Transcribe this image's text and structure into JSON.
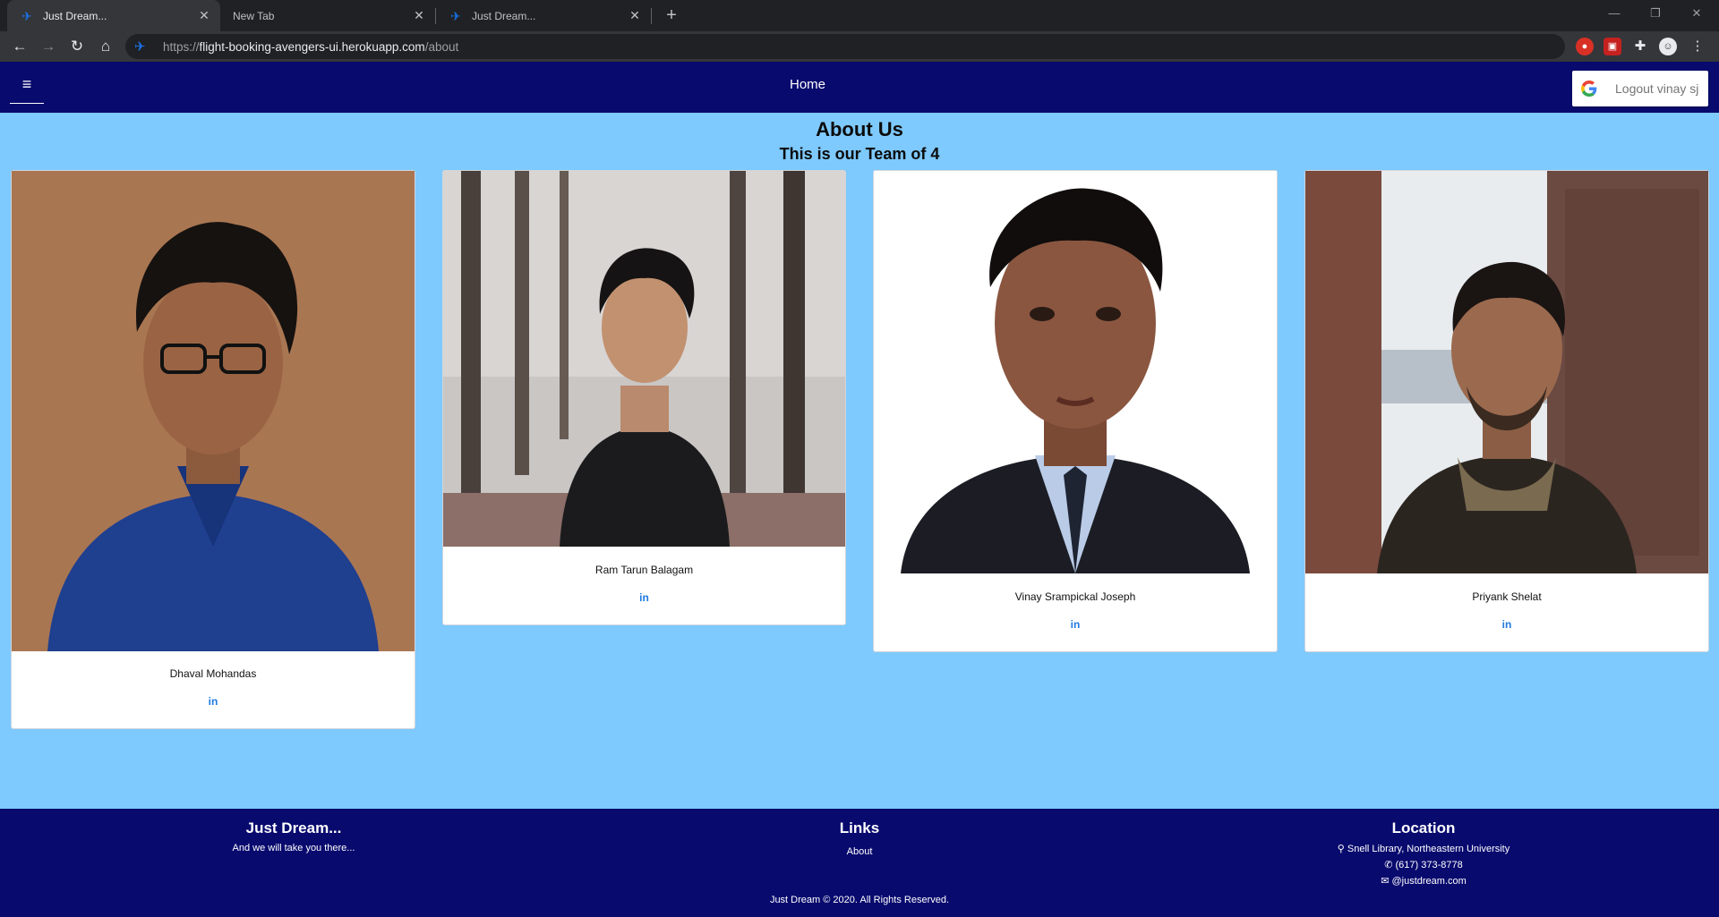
{
  "browser": {
    "tabs": [
      {
        "title": "Just Dream...",
        "active": true
      },
      {
        "title": "New Tab",
        "active": false
      },
      {
        "title": "Just Dream...",
        "active": false
      }
    ],
    "url_scheme": "https://",
    "url_host": "flight-booking-avengers-ui.herokuapp.com",
    "url_path": "/about",
    "new_tab_symbol": "+",
    "close_symbol": "✕"
  },
  "navbar": {
    "menu_icon": "≡",
    "home_label": "Home",
    "logout_label": "Logout vinay sj"
  },
  "main": {
    "title": "About Us",
    "subtitle": "This is our Team of 4",
    "members": [
      {
        "name": "Dhaval Mohandas",
        "link_label": "in"
      },
      {
        "name": "Ram Tarun Balagam",
        "link_label": "in"
      },
      {
        "name": "Vinay Srampickal Joseph",
        "link_label": "in"
      },
      {
        "name": "Priyank Shelat",
        "link_label": "in"
      }
    ]
  },
  "footer": {
    "brand_title": "Just Dream...",
    "brand_tagline": "And we will take you there...",
    "links_title": "Links",
    "links": [
      "About"
    ],
    "location_title": "Location",
    "address": "Snell Library, Northeastern University",
    "phone": "(617) 373-8778",
    "email": "@justdream.com",
    "copyright_prefix": "Just Dream",
    "copyright_suffix": "2020. All Rights Reserved."
  },
  "colors": {
    "page_bg": "#7ec9fd",
    "navbar_bg": "#080a6e",
    "link_blue": "#1f7ae0"
  },
  "icons": {
    "favicon": "airplane-icon",
    "menu": "hamburger-menu-icon",
    "google": "google-g-icon",
    "linkedin": "linkedin-icon",
    "location": "map-marker-icon",
    "phone": "phone-icon",
    "email": "envelope-icon",
    "copyright": "copyright-icon"
  }
}
